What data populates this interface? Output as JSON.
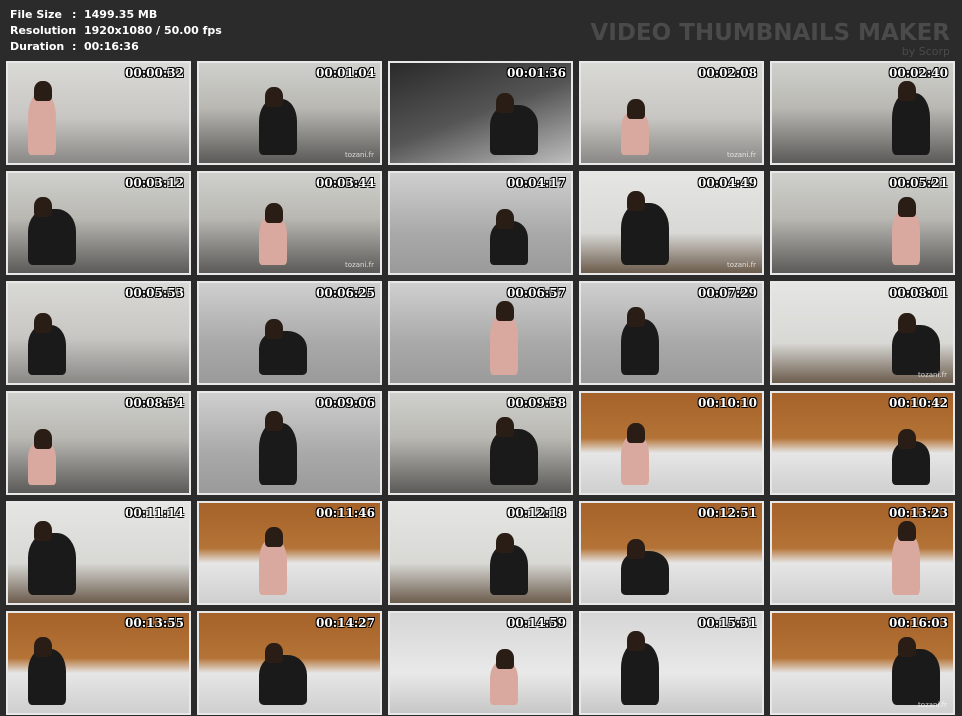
{
  "header": {
    "rows": [
      {
        "key": "File Size",
        "sep": ":",
        "value": "1499.35 MB"
      },
      {
        "key": "Resolution",
        "sep": ":",
        "value": "1920x1080 / 50.00 fps"
      },
      {
        "key": "Duration",
        "sep": ":",
        "value": "00:16:36"
      }
    ],
    "brand_title": "VIDEO THUMBNAILS MAKER",
    "brand_sub": "by Scorp"
  },
  "thumbnails": [
    {
      "time": "00:00:32",
      "scene": "bright",
      "watermark": ""
    },
    {
      "time": "00:01:04",
      "scene": "kitchen",
      "watermark": "tozani.fr"
    },
    {
      "time": "00:01:36",
      "scene": "dark",
      "watermark": ""
    },
    {
      "time": "00:02:08",
      "scene": "bright",
      "watermark": "tozani.fr"
    },
    {
      "time": "00:02:40",
      "scene": "kitchen",
      "watermark": ""
    },
    {
      "time": "00:03:12",
      "scene": "kitchen",
      "watermark": ""
    },
    {
      "time": "00:03:44",
      "scene": "kitchen",
      "watermark": "tozani.fr"
    },
    {
      "time": "00:04:17",
      "scene": "floor",
      "watermark": ""
    },
    {
      "time": "00:04:49",
      "scene": "white",
      "watermark": "tozani.fr"
    },
    {
      "time": "00:05:21",
      "scene": "kitchen",
      "watermark": ""
    },
    {
      "time": "00:05:53",
      "scene": "bright",
      "watermark": ""
    },
    {
      "time": "00:06:25",
      "scene": "floor",
      "watermark": ""
    },
    {
      "time": "00:06:57",
      "scene": "floor",
      "watermark": ""
    },
    {
      "time": "00:07:29",
      "scene": "floor",
      "watermark": ""
    },
    {
      "time": "00:08:01",
      "scene": "white",
      "watermark": "tozani.fr"
    },
    {
      "time": "00:08:34",
      "scene": "kitchen",
      "watermark": ""
    },
    {
      "time": "00:09:06",
      "scene": "floor",
      "watermark": ""
    },
    {
      "time": "00:09:38",
      "scene": "kitchen",
      "watermark": ""
    },
    {
      "time": "00:10:10",
      "scene": "wood",
      "watermark": ""
    },
    {
      "time": "00:10:42",
      "scene": "wood",
      "watermark": ""
    },
    {
      "time": "00:11:14",
      "scene": "white",
      "watermark": ""
    },
    {
      "time": "00:11:46",
      "scene": "wood",
      "watermark": ""
    },
    {
      "time": "00:12:18",
      "scene": "white",
      "watermark": ""
    },
    {
      "time": "00:12:51",
      "scene": "wood",
      "watermark": ""
    },
    {
      "time": "00:13:23",
      "scene": "wood",
      "watermark": ""
    },
    {
      "time": "00:13:55",
      "scene": "wood",
      "watermark": ""
    },
    {
      "time": "00:14:27",
      "scene": "wood",
      "watermark": ""
    },
    {
      "time": "00:14:59",
      "scene": "tile",
      "watermark": ""
    },
    {
      "time": "00:15:31",
      "scene": "tile",
      "watermark": ""
    },
    {
      "time": "00:16:03",
      "scene": "wood",
      "watermark": "tozani.fr"
    }
  ]
}
